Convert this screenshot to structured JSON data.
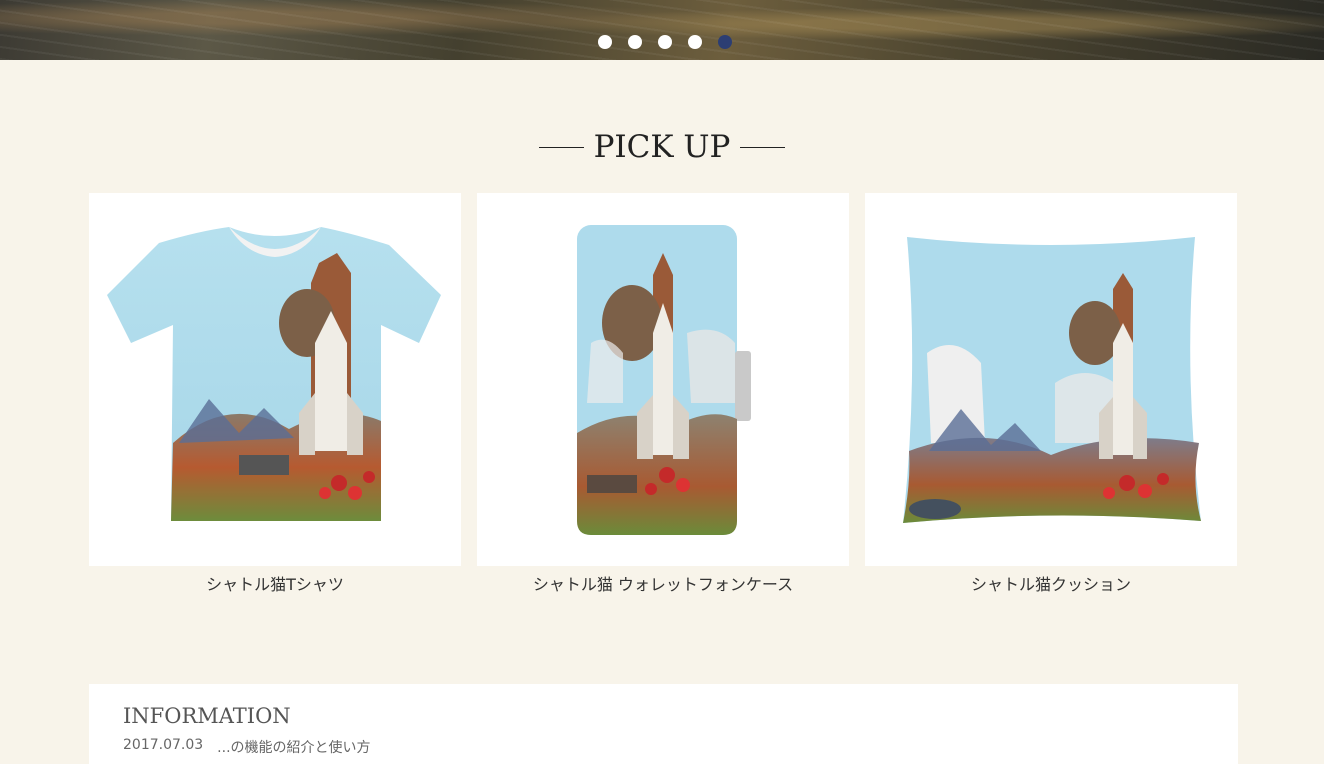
{
  "hero": {
    "slides_count": 5,
    "active_slide_index": 4
  },
  "pickup": {
    "title": "PICK UP",
    "products": [
      {
        "name": "シャトル猫Tシャツ",
        "image": "t-shirt"
      },
      {
        "name": "シャトル猫 ウォレットフォンケース",
        "image": "wallet-phone-case"
      },
      {
        "name": "シャトル猫クッション",
        "image": "cushion"
      }
    ]
  },
  "information": {
    "title": "INFORMATION",
    "latest": {
      "date": "2017.07.03",
      "text": "...の機能の紹介と使い方"
    }
  },
  "colors": {
    "page_bg": "#f8f4ea",
    "active_dot": "#2c3e73",
    "inactive_dot": "#ffffff",
    "sky": "#a8d8ea"
  }
}
